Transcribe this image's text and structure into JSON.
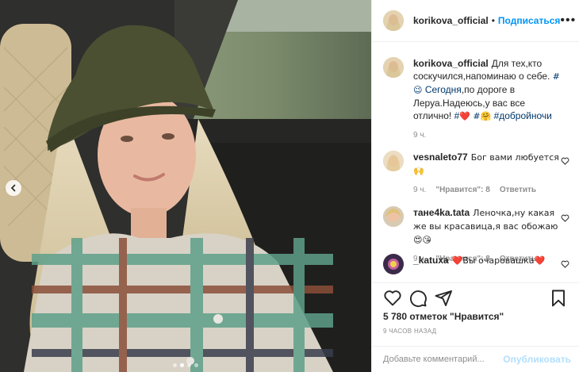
{
  "photo": {
    "prev_icon": "chevron-left-icon",
    "dot_count": 4,
    "active_dot": 2
  },
  "header": {
    "username": "korikova_official",
    "separator": "•",
    "follow_label": "Подписаться",
    "more_icon": "ellipsis-icon",
    "more_label": "•••"
  },
  "caption": {
    "username": "korikova_official",
    "text_1": "Для тех,кто соскучился,напоминаю о себе. ",
    "tag_1": "#😉",
    "text_2": " ",
    "tag_2": "Сегодня",
    "text_3": ",по дороге в Леруа.Надеюсь,у вас все отлично! ",
    "tag_3": "#",
    "emoji_heart": "❤️",
    "text_4": " ",
    "tag_4": "#🤗",
    "text_5": " ",
    "tag_5": "#добройночи",
    "time": "9 ч."
  },
  "comments": [
    {
      "username": "vesnaleto77",
      "text": "Бог вами любуется 🙌",
      "time": "9 ч.",
      "likes": "\"Нравится\": 8",
      "reply": "Ответить"
    },
    {
      "username": "тане4ka.tata",
      "text": "Леночка,ну какая же вы красавица,я вас обожаю 😍😘",
      "time": "9 ч.",
      "likes": "\"Нравится\": 8",
      "reply": "Ответить"
    },
    {
      "username": "_katuxa",
      "text": "❤️Вы очаровашка❤️"
    }
  ],
  "actions": {
    "like_icon": "heart-icon",
    "comment_icon": "comment-icon",
    "share_icon": "paper-plane-icon",
    "save_icon": "bookmark-icon"
  },
  "likes_text": "5 780 отметок \"Нравится\"",
  "posted_time": "9 ЧАСОВ НАЗАД",
  "composer": {
    "placeholder": "Добавьте комментарий...",
    "publish_label": "Опубликовать"
  },
  "colors": {
    "accent": "#0095f6",
    "publish_disabled": "#b2dffc",
    "hashtag": "#00376b",
    "muted": "#8e8e8e"
  }
}
